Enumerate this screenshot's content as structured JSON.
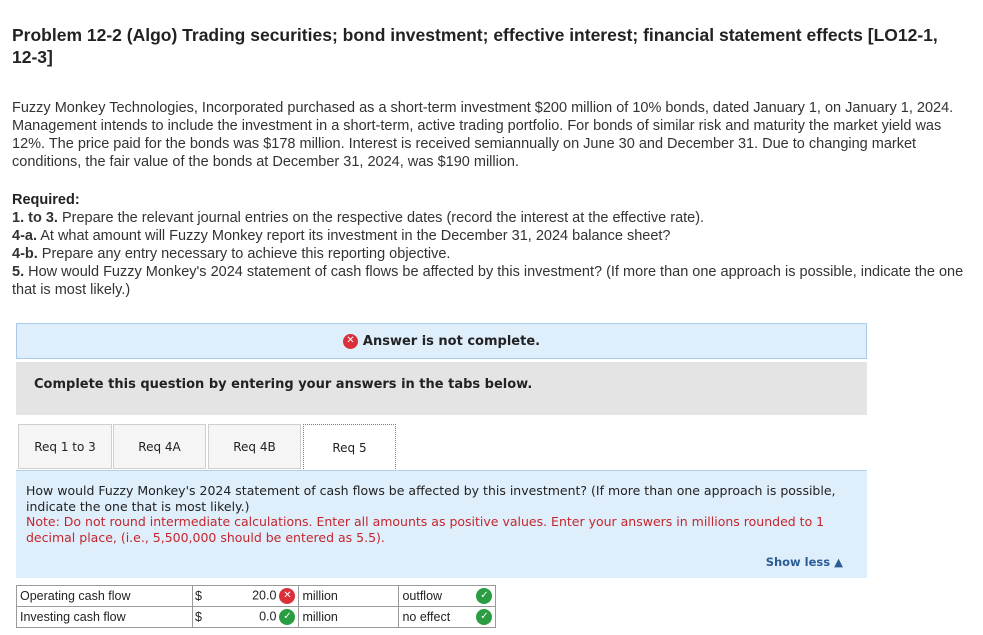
{
  "problem": {
    "title": "Problem 12-2 (Algo) Trading securities; bond investment; effective interest; financial statement effects [LO12-1, 12-3]",
    "intro": "Fuzzy Monkey Technologies, Incorporated purchased as a short-term investment $200 million of 10% bonds, dated January 1, on January 1, 2024. Management intends to include the investment in a short-term, active trading portfolio. For bonds of similar risk and maturity the market yield was 12%. The price paid for the bonds was $178 million. Interest is received semiannually on June 30 and December 31. Due to changing market conditions, the fair value of the bonds at December 31, 2024, was $190 million.",
    "required_heading": "Required:",
    "requirements": [
      {
        "num": "1. to 3.",
        "text": " Prepare the relevant journal entries on the respective dates (record the interest at the effective rate)."
      },
      {
        "num": "4-a.",
        "text": " At what amount will Fuzzy Monkey report its investment in the December 31, 2024 balance sheet?"
      },
      {
        "num": "4-b.",
        "text": " Prepare any entry necessary to achieve this reporting objective."
      },
      {
        "num": "5.",
        "text": " How would Fuzzy Monkey's 2024 statement of cash flows be affected by this investment? (If more than one approach is possible, indicate the one that is most likely.)"
      }
    ]
  },
  "status": {
    "banner_text": "Answer is not complete.",
    "banner_icon": "x-circle-icon",
    "bad_color": "#d9303a",
    "good_color": "#2a9d43"
  },
  "instructions": "Complete this question by entering your answers in the tabs below.",
  "tabs": [
    {
      "label": "Req 1 to 3"
    },
    {
      "label": "Req 4A"
    },
    {
      "label": "Req 4B"
    },
    {
      "label": "Req 5",
      "active": true
    }
  ],
  "panel": {
    "question": "How would Fuzzy Monkey's 2024 statement of cash flows be affected by this investment? (If more than one approach is possible, indicate the one that is most likely.)",
    "note": "Note: Do not round intermediate calculations. Enter all amounts as positive values. Enter your answers in millions rounded to 1 decimal place, (i.e., 5,500,000 should be entered as 5.5).",
    "show_less": "Show less"
  },
  "answers": [
    {
      "label": "Operating cash flow",
      "currency": "$",
      "value": "20.0",
      "value_status": "incorrect",
      "unit": "million",
      "effect": "outflow",
      "effect_status": "correct"
    },
    {
      "label": "Investing cash flow",
      "currency": "$",
      "value": "0.0",
      "value_status": "correct",
      "unit": "million",
      "effect": "no effect",
      "effect_status": "correct"
    }
  ]
}
